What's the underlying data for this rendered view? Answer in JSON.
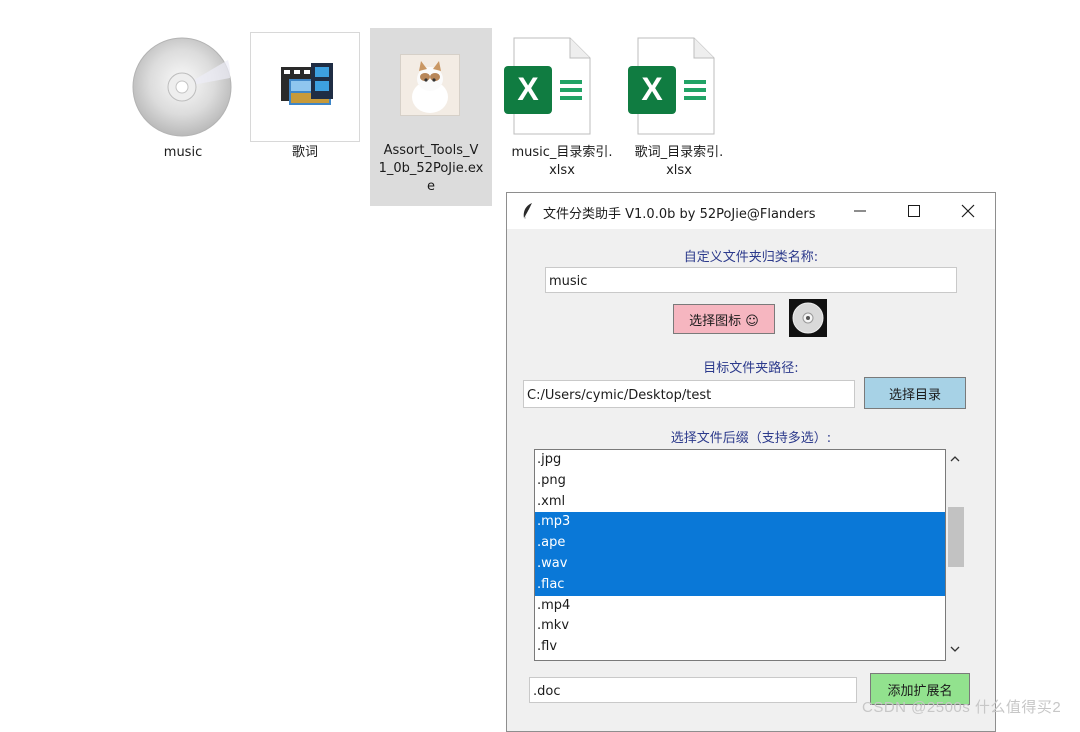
{
  "desktop": {
    "icons": [
      {
        "label": "music",
        "icon": "cd-icon"
      },
      {
        "label": "歌词",
        "icon": "movie-folder-icon"
      },
      {
        "label": "Assort_Tools_V\n1_0b_52PoJie.ex\ne",
        "icon": "cat-photo-icon"
      },
      {
        "label": "music_目录索引.\nxlsx",
        "icon": "excel-icon"
      },
      {
        "label": "歌词_目录索引.\nxlsx",
        "icon": "excel-icon"
      }
    ]
  },
  "window": {
    "title": "文件分类助手 V1.0.0b by 52PoJie@Flanders",
    "category_label": "自定义文件夹归类名称:",
    "category_value": "music",
    "choose_icon_label": "选择图标 ☺",
    "path_label": "目标文件夹路径:",
    "path_value": "C:/Users/cymic/Desktop/test",
    "choose_dir_label": "选择目录",
    "suffix_label": "选择文件后缀（支持多选）:",
    "suffixes": [
      {
        "label": ".jpg",
        "selected": false
      },
      {
        "label": ".png",
        "selected": false
      },
      {
        "label": ".xml",
        "selected": false
      },
      {
        "label": ".mp3",
        "selected": true
      },
      {
        "label": ".ape",
        "selected": true
      },
      {
        "label": ".wav",
        "selected": true
      },
      {
        "label": ".flac",
        "selected": true
      },
      {
        "label": ".mp4",
        "selected": false
      },
      {
        "label": ".mkv",
        "selected": false
      },
      {
        "label": ".flv",
        "selected": false
      }
    ],
    "ext_input_value": ".doc",
    "add_ext_label": "添加扩展名"
  },
  "watermark": "CSDN @2500s 什么值得买2",
  "colors": {
    "selection": "#0a78d7",
    "label_text": "#2c3a8c",
    "pink_button": "#f6b6c0",
    "blue_button": "#a7d2e6",
    "green_button": "#92e28e"
  }
}
